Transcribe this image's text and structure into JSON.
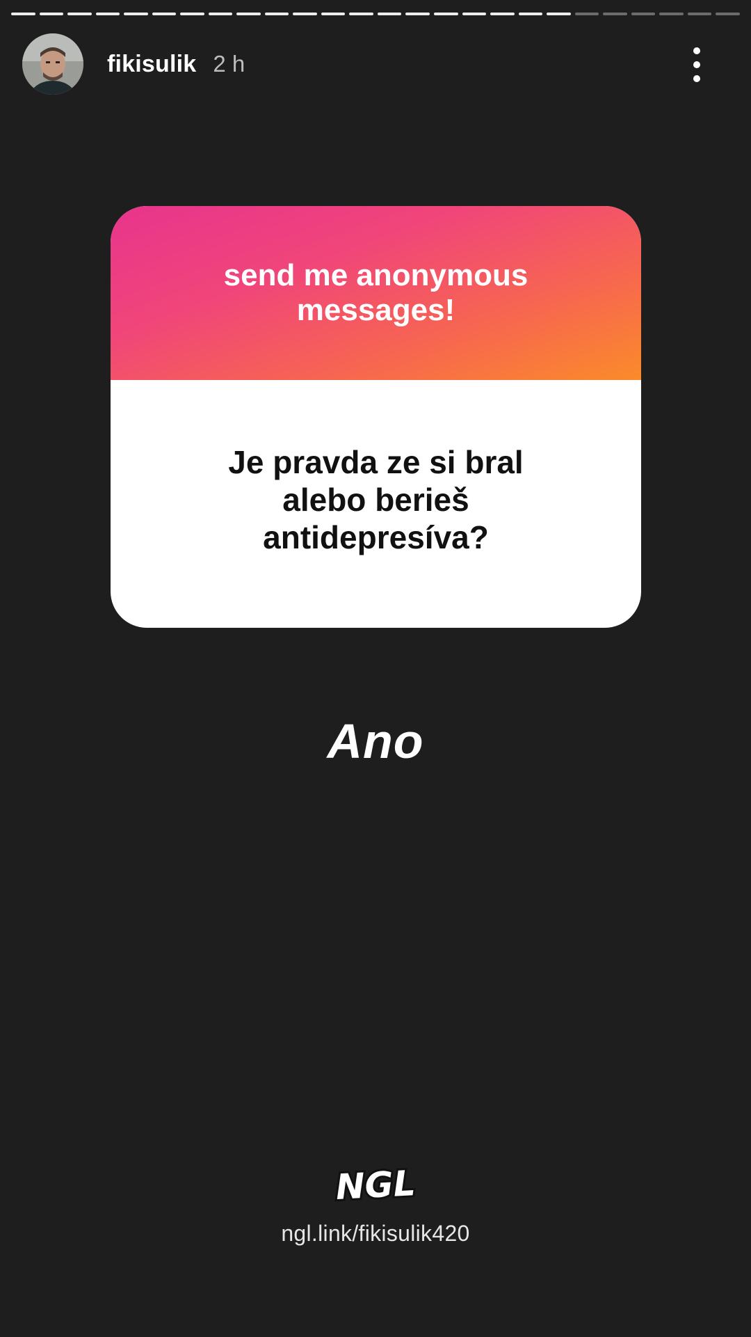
{
  "story": {
    "progress_segments_total": 26,
    "progress_segments_viewed": 20
  },
  "header": {
    "username": "fikisulik",
    "time_ago": "2 h",
    "avatar_icon": "profile-photo",
    "more_icon": "more-vertical-icon"
  },
  "card": {
    "prompt": "send me anonymous messages!",
    "question": "Je pravda ze si bral alebo berieš antidepresíva?",
    "gradient_colors": [
      "#e8348d",
      "#f7674f",
      "#fb8b2a"
    ]
  },
  "answer": {
    "text": "Ano"
  },
  "footer": {
    "logo_text": "NGL",
    "link": "ngl.link/fikisulik420"
  }
}
